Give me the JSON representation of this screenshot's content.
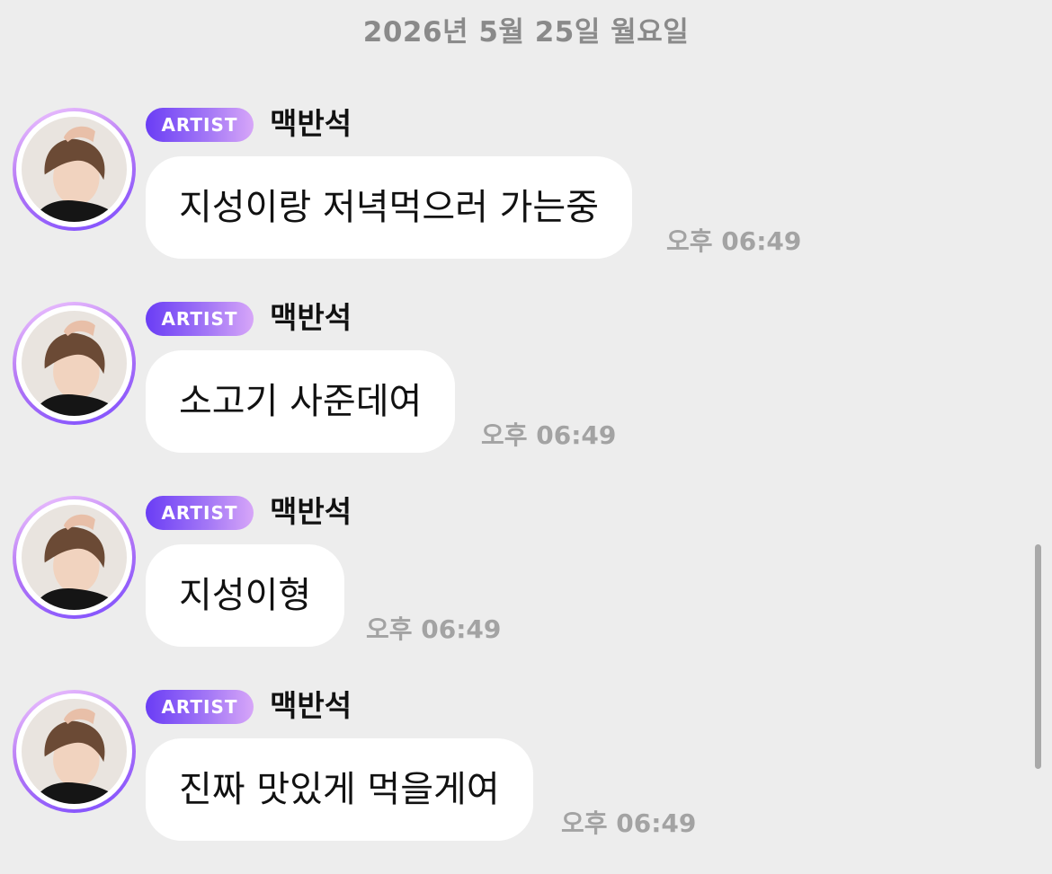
{
  "date_header": "2026년 5월 25일 월요일",
  "messages": [
    {
      "badge": "ARTIST",
      "sender": "맥반석",
      "text": "지성이랑 저녁먹으러 가는중",
      "time": "오후 06:49"
    },
    {
      "badge": "ARTIST",
      "sender": "맥반석",
      "text": "소고기 사준데여",
      "time": "오후 06:49"
    },
    {
      "badge": "ARTIST",
      "sender": "맥반석",
      "text": "지성이형",
      "time": "오후 06:49"
    },
    {
      "badge": "ARTIST",
      "sender": "맥반석",
      "text": "진짜 맛있게 먹을게여",
      "time": "오후 06:49"
    }
  ],
  "colors": {
    "background": "#ededed",
    "bubble": "#ffffff",
    "badge_start": "#6a3df5",
    "badge_end": "#d7a6f8",
    "avatar_ring": "#b77af5",
    "time_text": "#a3a3a3",
    "date_text": "#8a8a8a"
  },
  "icons": {
    "avatar": "profile-photo"
  }
}
